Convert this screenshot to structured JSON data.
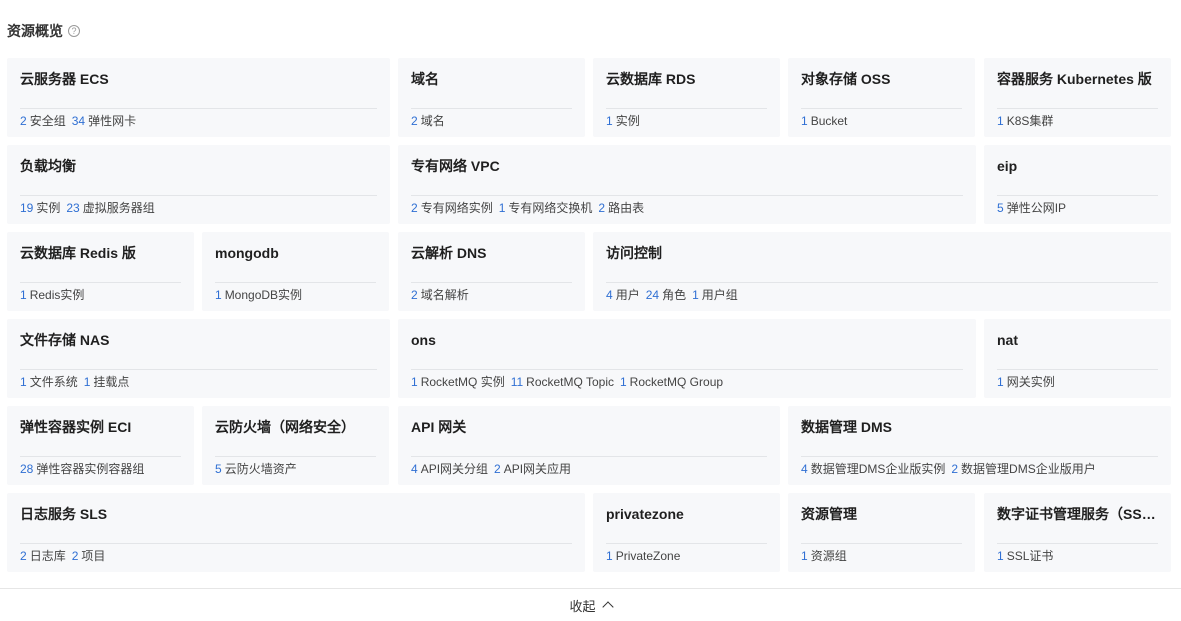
{
  "header": {
    "title": "资源概览",
    "help_icon": "?"
  },
  "cards": [
    {
      "title": "云服务器 ECS",
      "stats": [
        {
          "num": "2",
          "label": "安全组"
        },
        {
          "num": "34",
          "label": "弹性网卡"
        }
      ]
    },
    {
      "title": "域名",
      "stats": [
        {
          "num": "2",
          "label": "域名"
        }
      ]
    },
    {
      "title": "云数据库 RDS",
      "stats": [
        {
          "num": "1",
          "label": "实例"
        }
      ]
    },
    {
      "title": "对象存储 OSS",
      "stats": [
        {
          "num": "1",
          "label": "Bucket"
        }
      ]
    },
    {
      "title": "容器服务 Kubernetes 版",
      "stats": [
        {
          "num": "1",
          "label": "K8S集群"
        }
      ]
    },
    {
      "title": "负载均衡",
      "stats": [
        {
          "num": "19",
          "label": "实例"
        },
        {
          "num": "23",
          "label": "虚拟服务器组"
        }
      ]
    },
    {
      "title": "专有网络 VPC",
      "stats": [
        {
          "num": "2",
          "label": "专有网络实例"
        },
        {
          "num": "1",
          "label": "专有网络交换机"
        },
        {
          "num": "2",
          "label": "路由表"
        }
      ]
    },
    {
      "title": "eip",
      "stats": [
        {
          "num": "5",
          "label": "弹性公网IP"
        }
      ]
    },
    {
      "title": "云数据库 Redis 版",
      "stats": [
        {
          "num": "1",
          "label": "Redis实例"
        }
      ]
    },
    {
      "title": "mongodb",
      "stats": [
        {
          "num": "1",
          "label": "MongoDB实例"
        }
      ]
    },
    {
      "title": "云解析 DNS",
      "stats": [
        {
          "num": "2",
          "label": "域名解析"
        }
      ]
    },
    {
      "title": "访问控制",
      "stats": [
        {
          "num": "4",
          "label": "用户"
        },
        {
          "num": "24",
          "label": "角色"
        },
        {
          "num": "1",
          "label": "用户组"
        }
      ]
    },
    {
      "title": "文件存储 NAS",
      "stats": [
        {
          "num": "1",
          "label": "文件系统"
        },
        {
          "num": "1",
          "label": "挂载点"
        }
      ]
    },
    {
      "title": "ons",
      "stats": [
        {
          "num": "1",
          "label": "RocketMQ 实例"
        },
        {
          "num": "11",
          "label": "RocketMQ Topic"
        },
        {
          "num": "1",
          "label": "RocketMQ Group"
        }
      ]
    },
    {
      "title": "nat",
      "stats": [
        {
          "num": "1",
          "label": "网关实例"
        }
      ]
    },
    {
      "title": "弹性容器实例 ECI",
      "stats": [
        {
          "num": "28",
          "label": "弹性容器实例容器组"
        }
      ]
    },
    {
      "title": "云防火墙（网络安全）",
      "stats": [
        {
          "num": "5",
          "label": "云防火墙资产"
        }
      ]
    },
    {
      "title": "API 网关",
      "stats": [
        {
          "num": "4",
          "label": "API网关分组"
        },
        {
          "num": "2",
          "label": "API网关应用"
        }
      ]
    },
    {
      "title": "数据管理 DMS",
      "stats": [
        {
          "num": "4",
          "label": "数据管理DMS企业版实例"
        },
        {
          "num": "2",
          "label": "数据管理DMS企业版用户"
        }
      ]
    },
    {
      "title": "日志服务 SLS",
      "stats": [
        {
          "num": "2",
          "label": "日志库"
        },
        {
          "num": "2",
          "label": "项目"
        }
      ]
    },
    {
      "title": "privatezone",
      "stats": [
        {
          "num": "1",
          "label": "PrivateZone"
        }
      ]
    },
    {
      "title": "资源管理",
      "stats": [
        {
          "num": "1",
          "label": "资源组"
        }
      ]
    },
    {
      "title": "数字证书管理服务（SSL证书）",
      "stats": [
        {
          "num": "1",
          "label": "SSL证书"
        }
      ]
    }
  ],
  "footer": {
    "collapse_label": "收起"
  }
}
